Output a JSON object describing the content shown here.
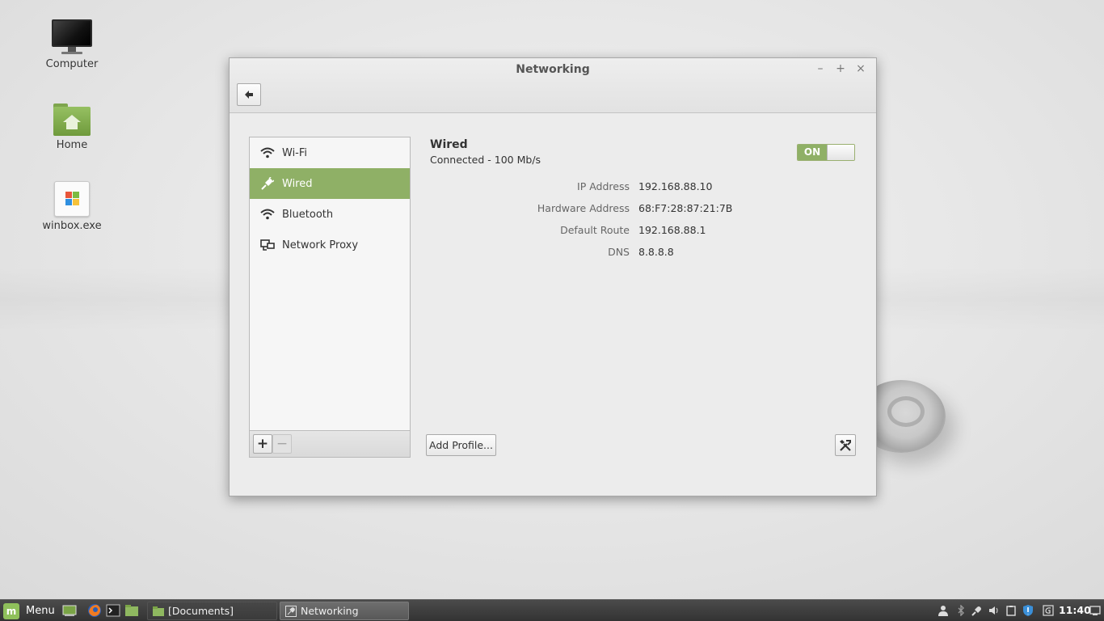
{
  "desktop": {
    "icons": [
      {
        "label": "Computer"
      },
      {
        "label": "Home"
      },
      {
        "label": "winbox.exe"
      }
    ]
  },
  "window": {
    "title": "Networking",
    "controls": {
      "minimize": "–",
      "maximize": "+",
      "close": "×"
    }
  },
  "sidebar": {
    "items": [
      {
        "label": "Wi-Fi",
        "icon": "wifi-icon"
      },
      {
        "label": "Wired",
        "icon": "wired-plug-icon",
        "selected": true
      },
      {
        "label": "Bluetooth",
        "icon": "wifi-icon"
      },
      {
        "label": "Network Proxy",
        "icon": "network-proxy-icon"
      }
    ],
    "add_label": "+",
    "remove_label": "−"
  },
  "detail": {
    "name": "Wired",
    "status": "Connected - 100 Mb/s",
    "toggle_label": "ON",
    "rows": [
      {
        "key": "IP Address",
        "value": "192.168.88.10"
      },
      {
        "key": "Hardware Address",
        "value": "68:F7:28:87:21:7B"
      },
      {
        "key": "Default Route",
        "value": "192.168.88.1"
      },
      {
        "key": "DNS",
        "value": "8.8.8.8"
      }
    ],
    "add_profile_label": "Add Profile..."
  },
  "taskbar": {
    "menu_label": "Menu",
    "tasks": [
      {
        "label": "[Documents]"
      },
      {
        "label": "Networking"
      }
    ],
    "clock": "11:40"
  },
  "colors": {
    "accent": "#8fb066",
    "taskbar": "#3a3a3a"
  }
}
